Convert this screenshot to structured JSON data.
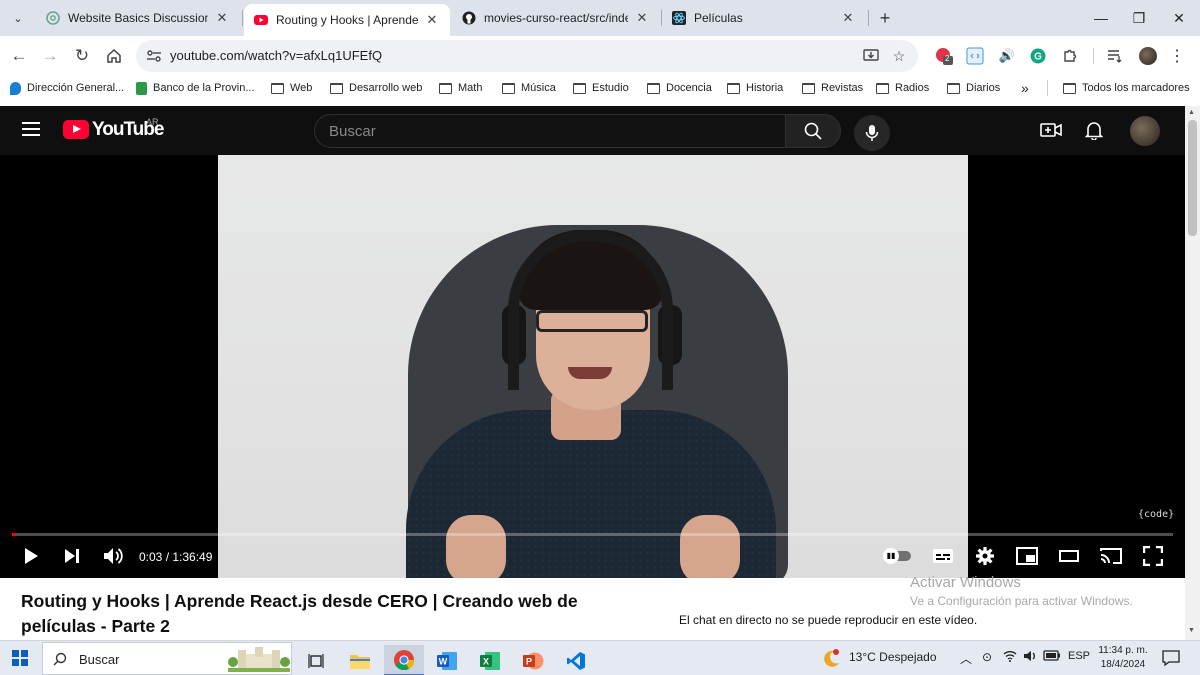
{
  "browser": {
    "tabs": [
      {
        "title": "Website Basics Discussion"
      },
      {
        "title": "Routing y Hooks | Aprende React"
      },
      {
        "title": "movies-curso-react/src/index.c"
      },
      {
        "title": "Películas"
      }
    ],
    "url": "youtube.com/watch?v=afxLq1UFEfQ",
    "extension_badge": "2",
    "bookmarks": [
      {
        "label": "Dirección General..."
      },
      {
        "label": "Banco de la Provin..."
      },
      {
        "label": "Web"
      },
      {
        "label": "Desarrollo web"
      },
      {
        "label": "Math"
      },
      {
        "label": "Música"
      },
      {
        "label": "Estudio"
      },
      {
        "label": "Docencia"
      },
      {
        "label": "Historia"
      },
      {
        "label": "Revistas"
      },
      {
        "label": "Radios"
      },
      {
        "label": "Diarios"
      }
    ],
    "overflow_label": "»",
    "all_bookmarks": "Todos los marcadores"
  },
  "youtube": {
    "logo_text": "YouTube",
    "country": "AR",
    "search_placeholder": "Buscar",
    "player": {
      "time": "0:03 / 1:36:49",
      "progress": 0.0005,
      "overlay_tag": "{code}"
    },
    "video_title": "Routing y Hooks | Aprende React.js desde CERO | Creando web de películas - Parte 2",
    "chat_message": "El chat en directo no se puede reproducir en este vídeo."
  },
  "watermark": {
    "line1": "Activar Windows",
    "line2": "Ve a Configuración para activar Windows."
  },
  "taskbar": {
    "search_placeholder": "Buscar",
    "weather": "13°C  Despejado",
    "language": "ESP",
    "time": "11:34 p. m.",
    "date": "18/4/2024"
  },
  "colors": {
    "youtube_red": "#ff0033",
    "progress": "#ff0000",
    "chrome_tabstrip": "#dee3eb"
  }
}
